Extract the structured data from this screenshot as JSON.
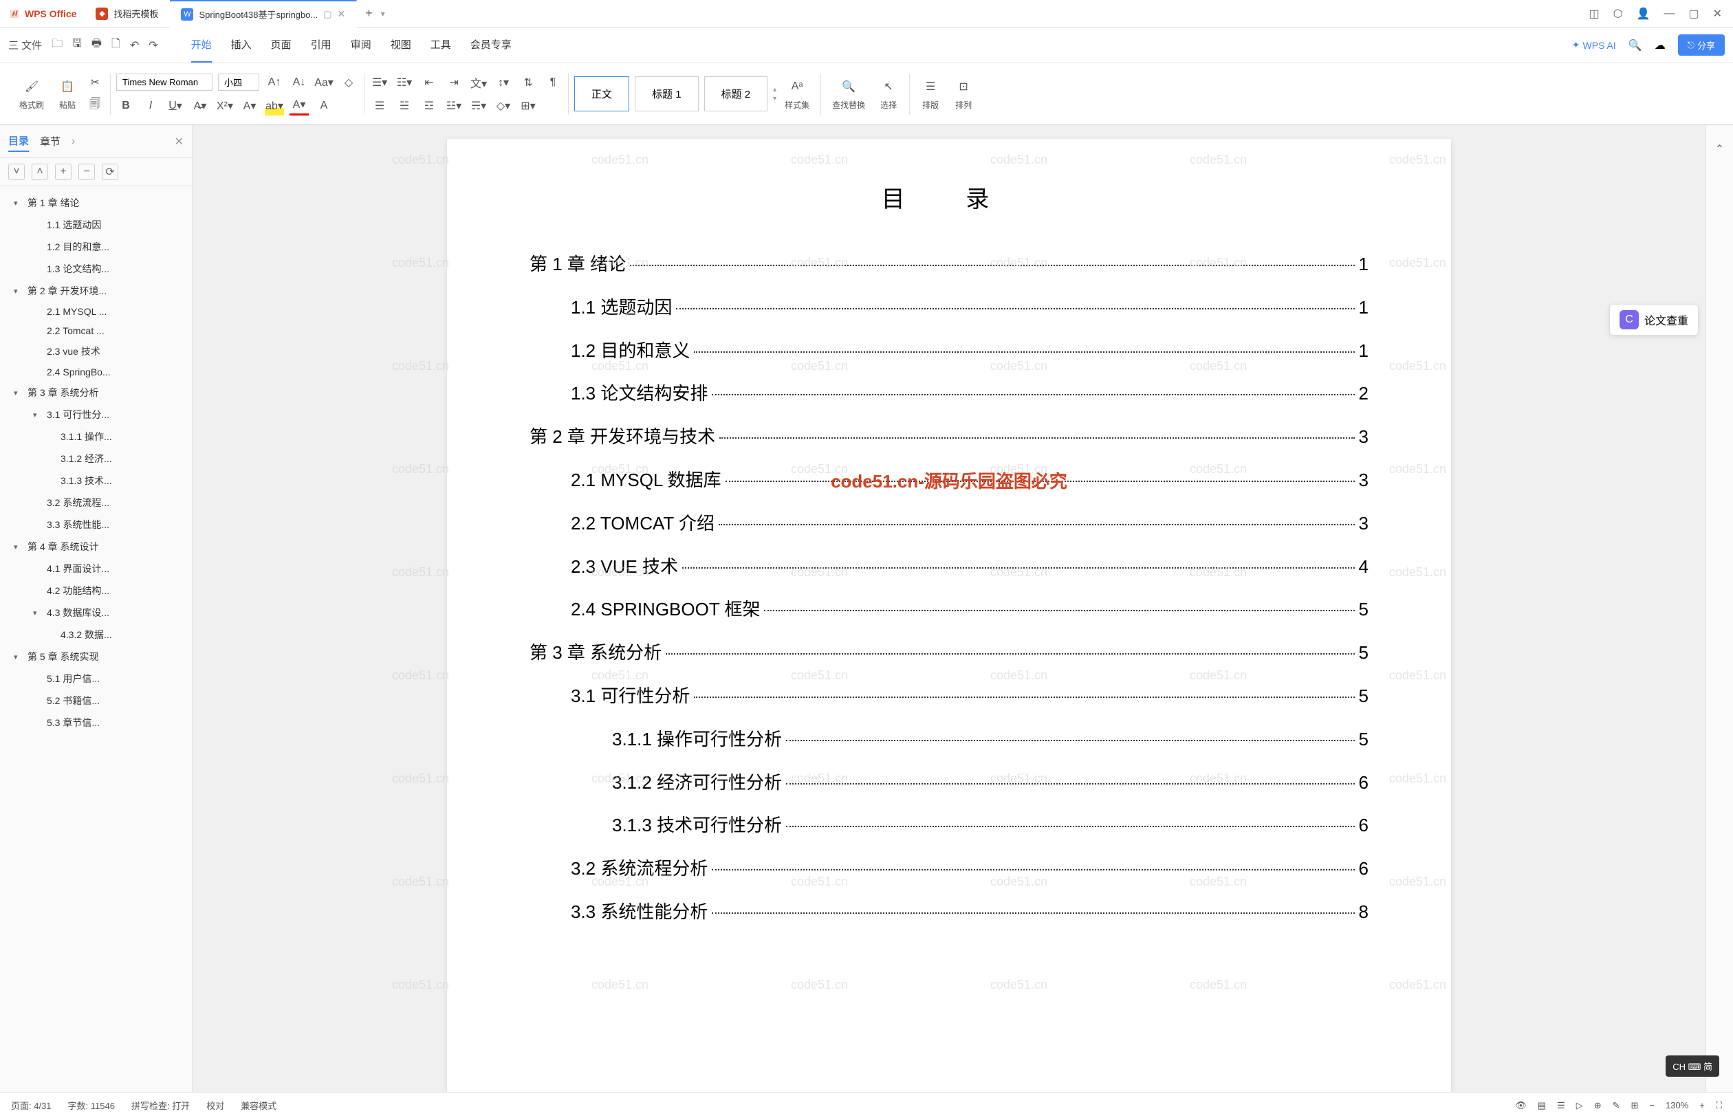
{
  "app": {
    "name": "WPS Office"
  },
  "tabs": [
    {
      "label": "找稻壳模板",
      "icon_color": "#d14424"
    },
    {
      "label": "SpringBoot438基于springbo...",
      "icon_letter": "W",
      "icon_color": "#4285f4",
      "active": true
    }
  ],
  "menubar": {
    "file": "三 文件",
    "tabs": [
      "开始",
      "插入",
      "页面",
      "引用",
      "审阅",
      "视图",
      "工具",
      "会员专享"
    ],
    "active_tab": "开始",
    "wps_ai": "WPS AI",
    "share": "分享"
  },
  "ribbon": {
    "format_brush": "格式刷",
    "paste": "粘贴",
    "font_name": "Times New Roman",
    "font_size": "小四",
    "styles": {
      "normal": "正文",
      "h1": "标题 1",
      "h2": "标题 2"
    },
    "style_set": "样式集",
    "find_replace": "查找替换",
    "select": "选择",
    "arrange": "排版",
    "align": "排列"
  },
  "sidebar": {
    "tabs": {
      "toc": "目录",
      "chapter": "章节"
    },
    "outline": [
      {
        "level": 1,
        "text": "第 1 章 绪论",
        "expanded": true
      },
      {
        "level": 2,
        "text": "1.1 选题动因"
      },
      {
        "level": 2,
        "text": "1.2 目的和意..."
      },
      {
        "level": 2,
        "text": "1.3 论文结构..."
      },
      {
        "level": 1,
        "text": "第 2 章 开发环境...",
        "expanded": true
      },
      {
        "level": 2,
        "text": "2.1 MYSQL ..."
      },
      {
        "level": 2,
        "text": "2.2 Tomcat ..."
      },
      {
        "level": 2,
        "text": "2.3 vue 技术"
      },
      {
        "level": 2,
        "text": "2.4 SpringBo..."
      },
      {
        "level": 1,
        "text": "第 3 章 系统分析",
        "expanded": true
      },
      {
        "level": 2,
        "text": "3.1 可行性分...",
        "expanded": true
      },
      {
        "level": 3,
        "text": "3.1.1 操作..."
      },
      {
        "level": 3,
        "text": "3.1.2 经济..."
      },
      {
        "level": 3,
        "text": "3.1.3 技术..."
      },
      {
        "level": 2,
        "text": "3.2 系统流程..."
      },
      {
        "level": 2,
        "text": "3.3 系统性能..."
      },
      {
        "level": 1,
        "text": "第 4 章 系统设计",
        "expanded": true
      },
      {
        "level": 2,
        "text": "4.1 界面设计..."
      },
      {
        "level": 2,
        "text": "4.2 功能结构..."
      },
      {
        "level": 2,
        "text": "4.3 数据库设...",
        "expanded": true
      },
      {
        "level": 3,
        "text": "4.3.2 数据..."
      },
      {
        "level": 1,
        "text": "第 5 章 系统实现",
        "expanded": true
      },
      {
        "level": 2,
        "text": "5.1 用户信..."
      },
      {
        "level": 2,
        "text": "5.2 书籍信..."
      },
      {
        "level": 2,
        "text": "5.3 章节信..."
      }
    ]
  },
  "document": {
    "toc_title": "目 录",
    "toc": [
      {
        "level": 1,
        "text": "第 1 章 绪论",
        "page": "1"
      },
      {
        "level": 2,
        "text": "1.1 选题动因",
        "page": "1"
      },
      {
        "level": 2,
        "text": "1.2 目的和意义",
        "page": "1"
      },
      {
        "level": 2,
        "text": "1.3 论文结构安排",
        "page": "2"
      },
      {
        "level": 1,
        "text": "第 2 章 开发环境与技术",
        "page": "3"
      },
      {
        "level": 2,
        "text": "2.1 MYSQL 数据库",
        "page": "3"
      },
      {
        "level": 2,
        "text": "2.2 TOMCAT 介绍",
        "page": "3"
      },
      {
        "level": 2,
        "text": "2.3 VUE 技术",
        "page": "4"
      },
      {
        "level": 2,
        "text": "2.4 SPRINGBOOT 框架",
        "page": "5"
      },
      {
        "level": 1,
        "text": "第 3 章 系统分析",
        "page": "5"
      },
      {
        "level": 2,
        "text": "3.1 可行性分析",
        "page": "5"
      },
      {
        "level": 3,
        "text": "3.1.1 操作可行性分析",
        "page": "5"
      },
      {
        "level": 3,
        "text": "3.1.2 经济可行性分析",
        "page": "6"
      },
      {
        "level": 3,
        "text": "3.1.3 技术可行性分析",
        "page": "6"
      },
      {
        "level": 2,
        "text": "3.2 系统流程分析",
        "page": "6"
      },
      {
        "level": 2,
        "text": "3.3 系统性能分析",
        "page": "8"
      }
    ],
    "red_watermark": "code51.cn-源码乐园盗图必究",
    "watermark_text": "code51.cn"
  },
  "paper_check": {
    "label": "论文查重"
  },
  "statusbar": {
    "page": "页面: 4/31",
    "words": "字数: 11546",
    "spell": "拼写检查: 打开",
    "proof": "校对",
    "compat": "兼容模式",
    "zoom": "130%"
  },
  "ime": "CH ⌨ 简"
}
